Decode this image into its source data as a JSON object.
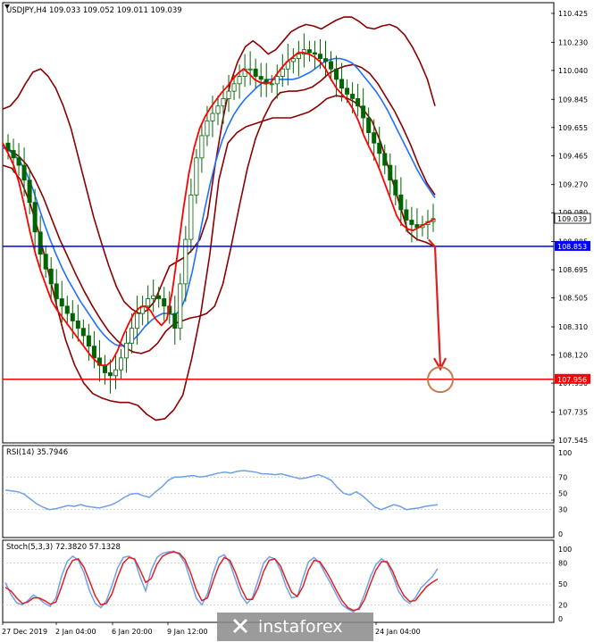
{
  "chart_data": {
    "type": "candlestick",
    "symbol_header": "USDJPY,H4  109.033 109.052 109.011 109.039",
    "price_axis": {
      "ylim": [
        107.545,
        110.425
      ],
      "ticks": [
        "110.425",
        "110.230",
        "110.040",
        "109.845",
        "109.655",
        "109.465",
        "109.270",
        "109.080",
        "108.885",
        "108.695",
        "108.505",
        "108.310",
        "108.120",
        "107.930",
        "107.735",
        "107.545"
      ]
    },
    "time_labels": [
      "27 Dec 2019",
      "2 Jan 04:00",
      "6 Jan 20:00",
      "9 Jan 12:00",
      "24 Jan 04:00"
    ],
    "current_price": {
      "label": "109.039",
      "value": 109.039
    },
    "support_line": {
      "label": "108.853",
      "value": 108.853,
      "color": "#0000ff"
    },
    "target_line": {
      "label": "107.956",
      "value": 107.956,
      "color": "#ff0000"
    },
    "forecast_arrow": {
      "from": 108.85,
      "to": 107.99,
      "color": "#e02020",
      "circle_color": "#c87a50"
    },
    "price_series": {
      "candle_close": [
        109.5,
        109.45,
        109.4,
        109.3,
        109.15,
        108.95,
        108.8,
        108.7,
        108.6,
        108.5,
        108.45,
        108.4,
        108.35,
        108.3,
        108.25,
        108.18,
        108.1,
        108.05,
        108.0,
        107.98,
        108.02,
        108.1,
        108.2,
        108.3,
        108.4,
        108.45,
        108.5,
        108.52,
        108.5,
        108.45,
        108.4,
        108.3,
        108.6,
        108.9,
        109.2,
        109.45,
        109.6,
        109.7,
        109.75,
        109.8,
        109.85,
        109.9,
        109.95,
        110.0,
        110.05,
        110.05,
        110.0,
        109.98,
        109.95,
        109.95,
        110.0,
        110.05,
        110.1,
        110.12,
        110.15,
        110.18,
        110.16,
        110.15,
        110.12,
        110.1,
        110.05,
        109.98,
        109.92,
        109.88,
        109.85,
        109.8,
        109.72,
        109.62,
        109.55,
        109.48,
        109.4,
        109.3,
        109.2,
        109.1,
        109.03,
        109.0,
        108.98,
        109.0,
        109.02,
        109.04
      ],
      "red_ma": [
        109.55,
        109.48,
        109.4,
        109.28,
        109.12,
        108.95,
        108.8,
        108.68,
        108.58,
        108.48,
        108.42,
        108.37,
        108.32,
        108.27,
        108.22,
        108.17,
        108.12,
        108.08,
        108.05,
        108.05,
        108.08,
        108.15,
        108.25,
        108.33,
        108.4,
        108.44,
        108.45,
        108.42,
        108.36,
        108.32,
        108.36,
        108.55,
        108.82,
        109.1,
        109.34,
        109.52,
        109.65,
        109.73,
        109.79,
        109.84,
        109.89,
        109.93,
        109.98,
        110.02,
        110.05,
        110.02,
        109.98,
        109.96,
        109.95,
        109.96,
        110.01,
        110.06,
        110.1,
        110.13,
        110.16,
        110.16,
        110.15,
        110.13,
        110.1,
        110.05,
        109.98,
        109.92,
        109.88,
        109.84,
        109.78,
        109.7,
        109.6,
        109.52,
        109.45,
        109.36,
        109.26,
        109.16,
        109.06,
        109.0,
        108.97,
        108.96,
        108.98,
        109.0,
        109.02,
        109.04
      ],
      "blue_ma": [
        109.52,
        109.5,
        109.47,
        109.42,
        109.35,
        109.25,
        109.13,
        109.01,
        108.9,
        108.8,
        108.71,
        108.63,
        108.56,
        108.49,
        108.43,
        108.37,
        108.31,
        108.26,
        108.22,
        108.19,
        108.18,
        108.19,
        108.22,
        108.26,
        108.31,
        108.35,
        108.38,
        108.4,
        108.4,
        108.39,
        108.42,
        108.52,
        108.68,
        108.88,
        109.08,
        109.27,
        109.43,
        109.56,
        109.66,
        109.74,
        109.8,
        109.85,
        109.89,
        109.93,
        109.96,
        109.98,
        109.98,
        109.98,
        109.98,
        109.98,
        109.99,
        110.01,
        110.03,
        110.06,
        110.09,
        110.11,
        110.12,
        110.12,
        110.11,
        110.09,
        110.05,
        110.0,
        109.95,
        109.9,
        109.84,
        109.77,
        109.69,
        109.61,
        109.53,
        109.45,
        109.37,
        109.3,
        109.24,
        109.18
      ],
      "bb_upper": [
        109.78,
        109.8,
        109.86,
        109.95,
        110.03,
        110.05,
        110.0,
        109.92,
        109.8,
        109.65,
        109.45,
        109.25,
        109.05,
        108.88,
        108.72,
        108.58,
        108.48,
        108.43,
        108.4,
        108.42,
        108.48,
        108.6,
        108.72,
        108.75,
        108.78,
        108.83,
        108.9,
        109.05,
        109.4,
        109.7,
        109.95,
        110.1,
        110.2,
        110.24,
        110.2,
        110.15,
        110.18,
        110.24,
        110.3,
        110.33,
        110.35,
        110.34,
        110.32,
        110.35,
        110.38,
        110.4,
        110.4,
        110.37,
        110.33,
        110.32,
        110.34,
        110.35,
        110.33,
        110.28,
        110.2,
        110.1,
        109.98,
        109.8
      ],
      "bb_mid": [
        109.52,
        109.5,
        109.46,
        109.4,
        109.3,
        109.18,
        109.04,
        108.9,
        108.78,
        108.66,
        108.55,
        108.45,
        108.36,
        108.28,
        108.22,
        108.17,
        108.14,
        108.13,
        108.15,
        108.2,
        108.28,
        108.33,
        108.35,
        108.37,
        108.38,
        108.4,
        108.45,
        108.6,
        108.85,
        109.12,
        109.38,
        109.58,
        109.72,
        109.83,
        109.89,
        109.9,
        109.9,
        109.91,
        109.93,
        109.97,
        110.02,
        110.05,
        110.07,
        110.08,
        110.06,
        110.02,
        109.95,
        109.86,
        109.77,
        109.66,
        109.54,
        109.4,
        109.28,
        109.2
      ],
      "bb_lower": [
        109.4,
        109.38,
        109.3,
        109.15,
        108.95,
        108.7,
        108.45,
        108.22,
        108.05,
        107.93,
        107.86,
        107.83,
        107.81,
        107.8,
        107.8,
        107.78,
        107.72,
        107.68,
        107.69,
        107.75,
        107.85,
        108.1,
        108.4,
        108.8,
        109.3,
        109.55,
        109.62,
        109.66,
        109.68,
        109.7,
        109.72,
        109.72,
        109.72,
        109.74,
        109.76,
        109.8,
        109.85,
        109.87,
        109.86,
        109.83,
        109.78,
        109.7,
        109.55,
        109.35,
        109.15,
        108.95,
        108.9,
        108.88,
        108.85
      ]
    },
    "rsi": {
      "label": "RSI(14) 35.7946",
      "ylim": [
        0,
        100
      ],
      "ticks": [
        "100",
        "70",
        "50",
        "30",
        "0"
      ],
      "values": [
        54,
        53,
        52,
        49,
        43,
        37,
        33,
        30,
        31,
        33,
        35,
        34,
        36,
        34,
        33,
        32,
        34,
        36,
        40,
        45,
        49,
        50,
        47,
        45,
        52,
        58,
        66,
        70,
        70,
        71,
        72,
        70,
        71,
        73,
        75,
        76,
        75,
        77,
        78,
        77,
        76,
        74,
        74,
        73,
        74,
        72,
        70,
        68,
        69,
        71,
        73,
        70,
        66,
        57,
        50,
        48,
        52,
        47,
        40,
        33,
        30,
        33,
        36,
        34,
        30,
        31,
        32,
        34,
        35,
        36
      ]
    },
    "stoch": {
      "label": "Stoch(5,3,3) 72.3820 57.1328",
      "ylim": [
        0,
        100
      ],
      "ticks": [
        "100",
        "80",
        "50",
        "20",
        "0"
      ],
      "k_values": [
        52,
        35,
        23,
        20,
        26,
        34,
        29,
        22,
        18,
        30,
        61,
        82,
        90,
        84,
        66,
        40,
        22,
        16,
        26,
        48,
        73,
        88,
        90,
        85,
        60,
        40,
        70,
        88,
        94,
        96,
        97,
        92,
        80,
        55,
        30,
        20,
        36,
        66,
        88,
        92,
        80,
        56,
        34,
        22,
        30,
        55,
        80,
        89,
        86,
        70,
        46,
        30,
        32,
        58,
        82,
        88,
        80,
        64,
        50,
        34,
        20,
        14,
        10,
        16,
        36,
        60,
        78,
        86,
        80,
        62,
        40,
        28,
        22,
        30,
        44,
        52,
        60,
        72
      ],
      "d_values": [
        45,
        40,
        30,
        22,
        24,
        30,
        30,
        26,
        21,
        24,
        46,
        70,
        84,
        86,
        74,
        54,
        33,
        20,
        22,
        36,
        60,
        80,
        88,
        86,
        70,
        52,
        58,
        78,
        90,
        94,
        96,
        94,
        85,
        66,
        42,
        26,
        30,
        54,
        76,
        88,
        84,
        66,
        44,
        28,
        28,
        44,
        68,
        84,
        86,
        76,
        56,
        38,
        32,
        46,
        70,
        84,
        82,
        70,
        56,
        40,
        26,
        16,
        12,
        14,
        28,
        50,
        70,
        82,
        82,
        68,
        48,
        33,
        25,
        26,
        36,
        46,
        52,
        57
      ]
    }
  },
  "watermark": {
    "text": "instaforex"
  },
  "colors": {
    "grid": "#c8c8c8",
    "dark_red": "#8b0000",
    "red_ma": "#ff0000",
    "blue_ma": "#1e70ff",
    "rsi_line": "#6fa0e8",
    "stoch_k": "#6fa0e8",
    "stoch_d": "#e02020",
    "candle": "#006400"
  }
}
